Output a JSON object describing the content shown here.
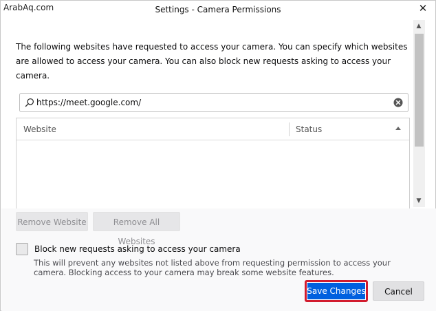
{
  "window": {
    "watermark": "ArabAq.com",
    "title": "Settings - Camera Permissions",
    "close_glyph": "✕"
  },
  "description": "The following websites have requested to access your camera. You can specify which websites are allowed to access your camera. You can also block new requests asking to access your camera.",
  "search": {
    "value": "https://meet.google.com/",
    "icon": "search-icon",
    "clear_icon": "clear-icon"
  },
  "table": {
    "columns": [
      {
        "label": "Website"
      },
      {
        "label": "Status",
        "sort": "ascending"
      }
    ],
    "rows": []
  },
  "scrollbar": {
    "up_glyph": "▲",
    "down_glyph": "▼"
  },
  "actions": {
    "remove_website": "Remove Website",
    "remove_all_websites": "Remove All Websites"
  },
  "block_option": {
    "label": "Block new requests asking to access your camera",
    "checked": false,
    "note": "This will prevent any websites not listed above from requesting permission to access your camera. Blocking access to your camera may break some website features."
  },
  "buttons": {
    "save": "Save Changes",
    "cancel": "Cancel"
  },
  "colors": {
    "primary": "#0060df",
    "highlight": "#d21c2e"
  }
}
